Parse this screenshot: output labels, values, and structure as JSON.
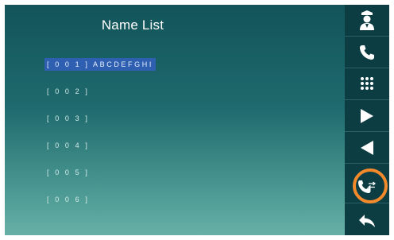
{
  "screen": {
    "title": "Name List",
    "items": [
      {
        "label": "[ 0 0 1 ] ABCDEFGHI",
        "selected": true
      },
      {
        "label": "[ 0 0 2 ]",
        "selected": false
      },
      {
        "label": "[ 0 0 3 ]",
        "selected": false
      },
      {
        "label": "[ 0 0 4 ]",
        "selected": false
      },
      {
        "label": "[ 0 0 5 ]",
        "selected": false
      },
      {
        "label": "[ 0 0 6 ]",
        "selected": false
      }
    ]
  },
  "sidebar": {
    "buttons": [
      {
        "icon": "guard-icon"
      },
      {
        "icon": "phone-icon"
      },
      {
        "icon": "keypad-icon"
      },
      {
        "icon": "play-right-icon"
      },
      {
        "icon": "play-left-icon"
      },
      {
        "icon": "call-list-icon"
      },
      {
        "icon": "back-arrow-icon"
      }
    ]
  },
  "colors": {
    "selection": "#2f5fb1",
    "highlight_ring": "#f28a2c",
    "sidebar": "#0b3d43"
  }
}
